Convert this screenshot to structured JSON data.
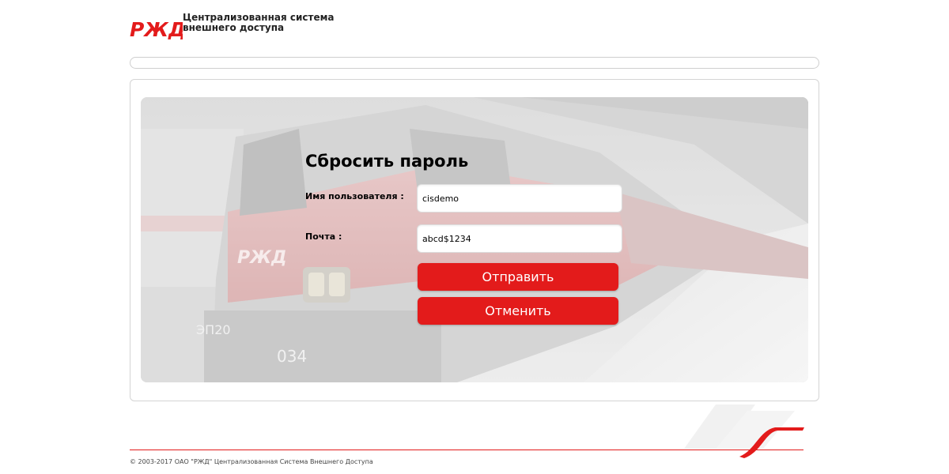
{
  "header": {
    "logo_text": "РЖД",
    "caption_line1": "Централизованная система",
    "caption_line2": "внешнего доступа"
  },
  "hero": {
    "loco_marking_model": "ЭП20",
    "loco_marking_number": "034",
    "loco_logo": "РЖД"
  },
  "form": {
    "title": "Сбросить пароль",
    "username_label": "Имя пользователя :",
    "username_value": "cisdemo",
    "email_label": "Почта :",
    "email_value": "abcd$1234",
    "submit_label": "Отправить",
    "cancel_label": "Отменить"
  },
  "footer": {
    "copyright": "© 2003-2017 ОАО \"РЖД\" Централизованная Система Внешнего Доступа"
  },
  "colors": {
    "brand_red": "#e31b1b",
    "border_grey": "#d4d4d4"
  }
}
